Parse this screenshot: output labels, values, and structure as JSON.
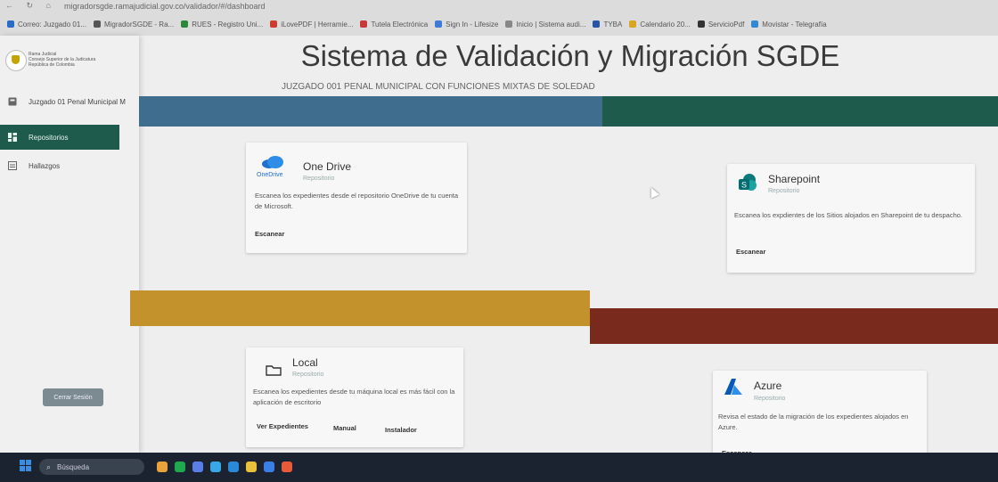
{
  "browser": {
    "nav": "← ↻ ⌂",
    "url": "migradorsgde.ramajudicial.gov.co/validador/#/dashboard",
    "bookmarks": [
      {
        "label": "Correo: Juzgado 01...",
        "color": "#2b6cc4"
      },
      {
        "label": "MigradorSGDE - Ra...",
        "color": "#555555"
      },
      {
        "label": "RUES - Registro Uni...",
        "color": "#2a8a3a"
      },
      {
        "label": "iLovePDF | Herramie...",
        "color": "#d23b2b"
      },
      {
        "label": "Tutela Electrónica",
        "color": "#c83a3a"
      },
      {
        "label": "Sign In - Lifesize",
        "color": "#3d7bd6"
      },
      {
        "label": "Inicio | Sistema audi...",
        "color": "#888888"
      },
      {
        "label": "TYBA",
        "color": "#2855a6"
      },
      {
        "label": "Calendario 20...",
        "color": "#d9a521"
      },
      {
        "label": "ServicioPdf",
        "color": "#333333"
      },
      {
        "label": "Movistar - Telegrafía",
        "color": "#2f8ad2"
      }
    ]
  },
  "sidebar": {
    "logo_lines": [
      "Rama Judicial",
      "Consejo Superior de la Judicatura",
      "República de Colombia"
    ],
    "items": [
      {
        "label": "Juzgado 01 Penal Municipal M",
        "icon": "badge-icon"
      },
      {
        "label": "Repositorios",
        "icon": "dashboard-icon",
        "active": true
      },
      {
        "label": "Hallazgos",
        "icon": "list-icon"
      }
    ],
    "logout_label": "Cerrar Sesión"
  },
  "main": {
    "title": "Sistema de Validación y Migración SGDE",
    "subtitle": "JUZGADO 001 PENAL MUNICIPAL CON FUNCIONES MIXTAS DE SOLEDAD"
  },
  "cards": {
    "onedrive": {
      "logo_text": "OneDrive",
      "title": "One Drive",
      "subtitle": "Repositorio",
      "description": "Escanea los expedientes desde el repositorio OneDrive de tu cuenta de Microsoft.",
      "action": "Escanear"
    },
    "sharepoint": {
      "title": "Sharepoint",
      "subtitle": "Repositorio",
      "description": "Escanea los expdientes de los Sitios alojados en Sharepoint de tu despacho.",
      "action": "Escanear"
    },
    "local": {
      "title": "Local",
      "subtitle": "Repositorio",
      "description": "Escanea los expedientes desde tu máquina local es más fácil con la aplicación de escritorio",
      "actions": [
        "Ver Expedientes",
        "Manual",
        "Instalador"
      ]
    },
    "azure": {
      "title": "Azure",
      "subtitle": "Repositorio",
      "description": "Revisa el estado de la migración de los expedientes alojados en Azure.",
      "action": "Escanear"
    }
  },
  "taskbar": {
    "search_label": "Búsqueda",
    "apps": [
      "#e8a33a",
      "#1fa84f",
      "#5a7ee8",
      "#3aa6e8",
      "#2a8ad8",
      "#e8c23a",
      "#3a7ee8",
      "#e85a3a"
    ]
  },
  "colors": {
    "band_blue": "#3e6d8e",
    "band_green": "#1e5b4c",
    "band_gold": "#c3922c",
    "band_maroon": "#7a2a1d",
    "sidebar_active": "#1e5b4c"
  }
}
